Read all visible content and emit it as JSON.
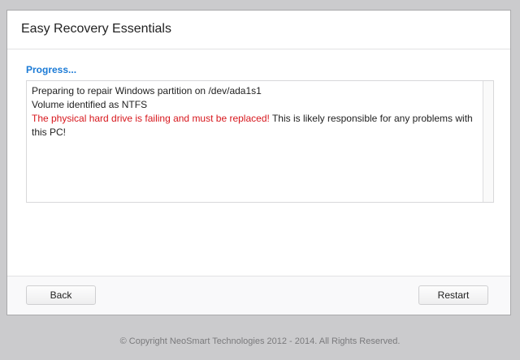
{
  "window": {
    "title": "Easy Recovery Essentials"
  },
  "progress": {
    "label": "Progress..."
  },
  "log": {
    "line1": "Preparing to repair Windows partition on /dev/ada1s1",
    "line2": "Volume identified as NTFS",
    "warning": "The physical hard drive is failing and must be replaced!",
    "warning_rest": " This is likely responsible for any problems with this PC!"
  },
  "buttons": {
    "back": "Back",
    "restart": "Restart"
  },
  "footer": {
    "copyright": "© Copyright NeoSmart Technologies 2012 - 2014. All Rights Reserved."
  },
  "colors": {
    "accent": "#1a7ad6",
    "error": "#d7171d",
    "background": "#cbcbcd"
  }
}
